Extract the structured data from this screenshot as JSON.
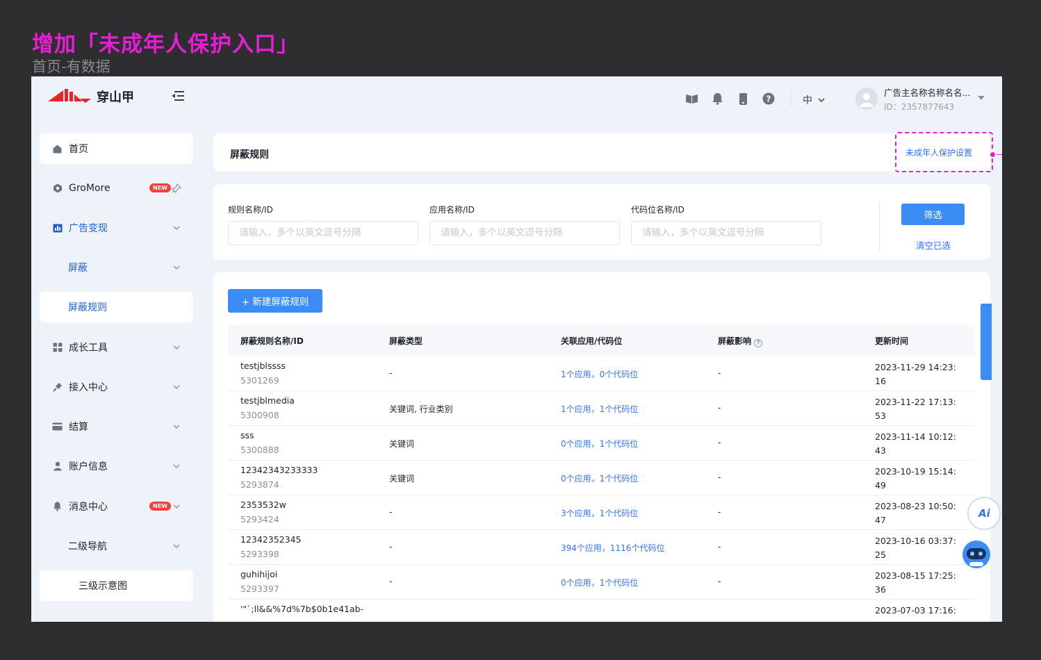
{
  "design": {
    "title": "增加「未成年人保护入口」",
    "subtitle": "首页-有数据"
  },
  "header": {
    "logo_text": "穿山甲",
    "icons": [
      "book-icon",
      "bell-icon",
      "phone-icon",
      "help-icon"
    ],
    "language": "中",
    "user_name": "广告主名称名称名名...",
    "user_id": "ID：2357877643"
  },
  "sidebar": {
    "items": [
      {
        "label": "首页",
        "icon": "home-icon"
      },
      {
        "label": "GroMore",
        "icon": "gromore-icon",
        "badge": "NEW"
      },
      {
        "label": "广告变现",
        "icon": "chart-icon"
      },
      {
        "label": "屏蔽"
      },
      {
        "label": "屏蔽规则"
      },
      {
        "label": "成长工具",
        "icon": "grid-icon"
      },
      {
        "label": "接入中心",
        "icon": "plug-icon"
      },
      {
        "label": "结算",
        "icon": "card-icon"
      },
      {
        "label": "账户信息",
        "icon": "user-icon"
      },
      {
        "label": "消息中心",
        "icon": "bell-icon",
        "badge": "NEW"
      },
      {
        "label": "二级导航"
      },
      {
        "label": "三级示意图"
      }
    ]
  },
  "page": {
    "title": "屏蔽规则",
    "minor_protect_link": "未成年人保护设置"
  },
  "filters": {
    "rule_label": "规则名称/ID",
    "app_label": "应用名称/ID",
    "slot_label": "代码位名称/ID",
    "placeholder": "请输入，多个以英文逗号分隔",
    "filter_button": "筛选",
    "clear_link": "清空已选"
  },
  "table": {
    "new_button": "+ 新建屏蔽规则",
    "columns": [
      "屏蔽规则名称/ID",
      "屏蔽类型",
      "关联应用/代码位",
      "屏蔽影响",
      "更新时间"
    ],
    "rows": [
      {
        "name": "testjblssss",
        "id": "5301269",
        "type": "-",
        "relation": "1个应用，0个代码位",
        "effect": "-",
        "time": "2023-11-29 14:23:16"
      },
      {
        "name": "testjblmedia",
        "id": "5300908",
        "type": "关键词, 行业类别",
        "relation": "1个应用，1个代码位",
        "effect": "-",
        "time": "2023-11-22 17:13:53"
      },
      {
        "name": "sss",
        "id": "5300888",
        "type": "关键词",
        "relation": "0个应用，1个代码位",
        "effect": "-",
        "time": "2023-11-14 10:12:43"
      },
      {
        "name": "12342343233333",
        "id": "5293874",
        "type": "关键词",
        "relation": "0个应用，1个代码位",
        "effect": "-",
        "time": "2023-10-19 15:14:49"
      },
      {
        "name": "2353532w",
        "id": "5293424",
        "type": "-",
        "relation": "3个应用，1个代码位",
        "effect": "-",
        "time": "2023-08-23 10:50:47"
      },
      {
        "name": "12342352345",
        "id": "5293398",
        "type": "-",
        "relation": "394个应用，1116个代码位",
        "effect": "-",
        "time": "2023-10-16 03:37:25"
      },
      {
        "name": "guhihijoi",
        "id": "5293397",
        "type": "-",
        "relation": "0个应用，1个代码位",
        "effect": "-",
        "time": "2023-08-15 17:25:36"
      },
      {
        "name": "'\"`;ll&&%7d%7b$0b1e41ab-",
        "id": "",
        "type": "",
        "relation": "",
        "effect": "",
        "time": "2023-07-03 17:16:"
      }
    ]
  },
  "floating": {
    "ai_label": "Ai"
  },
  "colors": {
    "accent": "#3b8cf5",
    "link": "#3370ff",
    "annotation": "#e81ed6"
  }
}
